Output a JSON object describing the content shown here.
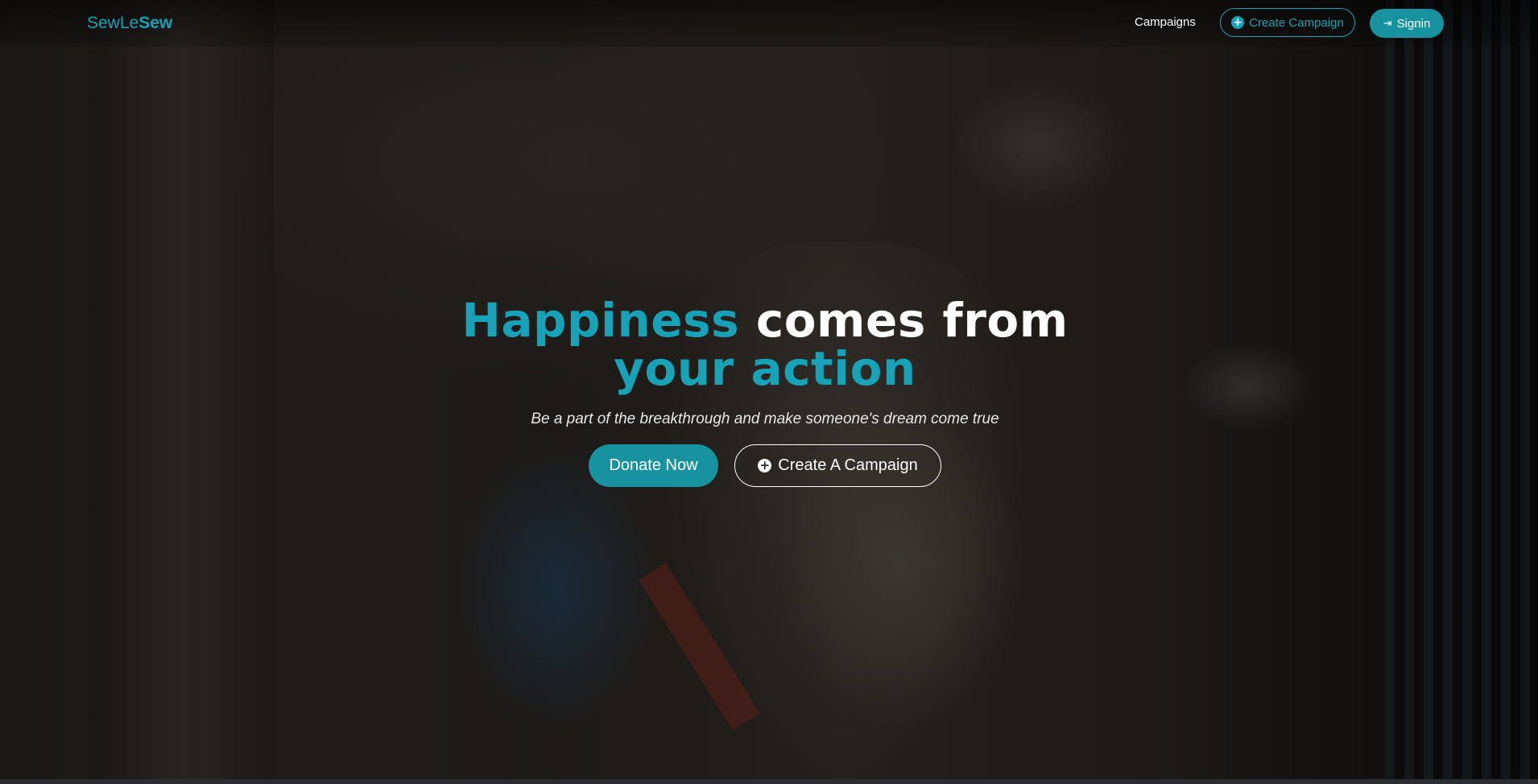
{
  "navbar": {
    "brand_light": "SewLe",
    "brand_bold": "Sew",
    "campaigns_link": "Campaigns",
    "create_campaign_button": "Create Campaign",
    "create_campaign_icon": "plus-circle-icon",
    "signin_button": "Signin",
    "signin_icon": "sign-in-icon"
  },
  "hero": {
    "headline_accent_1": "Happiness",
    "headline_plain": "comes from",
    "headline_accent_2": "your action",
    "subtitle": "Be a part of the breakthrough and make someone's dream come true",
    "donate_button": "Donate Now",
    "create_button": "Create A Campaign",
    "create_button_icon": "plus-circle-icon"
  },
  "colors": {
    "accent": "#17a2b8",
    "button_fill": "#17939f",
    "text": "#ffffff"
  }
}
